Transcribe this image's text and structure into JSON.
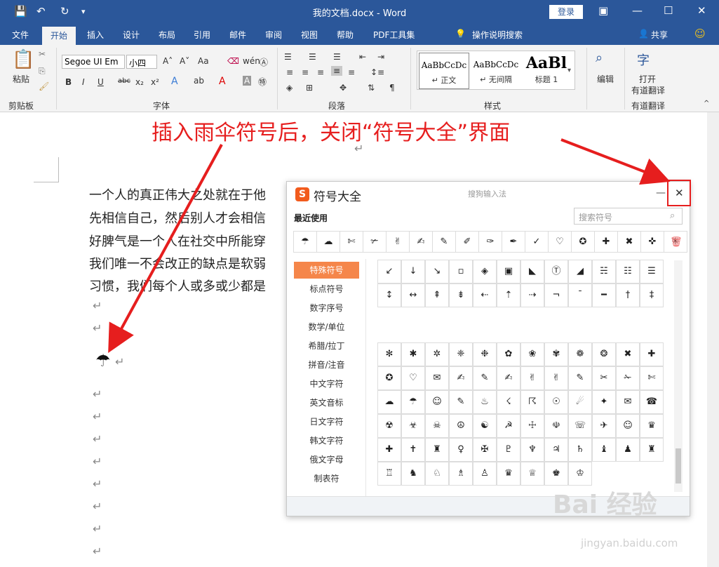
{
  "titlebar": {
    "title": "我的文档.docx  -  Word",
    "login": "登录",
    "save_icon": "💾",
    "undo_icon": "↶",
    "redo_icon": "↻",
    "more_icon": "▾",
    "ribbon_opt_icon": "▣",
    "min_icon": "—",
    "max_icon": "☐",
    "close_icon": "✕"
  },
  "tabs": {
    "items": [
      "文件",
      "开始",
      "插入",
      "设计",
      "布局",
      "引用",
      "邮件",
      "审阅",
      "视图",
      "帮助",
      "PDF工具集"
    ],
    "tell": "操作说明搜索",
    "share": "共享"
  },
  "ribbon": {
    "clipboard": {
      "paste": "粘贴",
      "label": "剪贴板"
    },
    "font": {
      "name": "Segoe UI Em",
      "size": "小四",
      "label": "字体",
      "bold": "B",
      "italic": "I",
      "underline": "U",
      "strike": "abc",
      "sub": "x₂",
      "sup": "x²",
      "aa": "Aa"
    },
    "paragraph": {
      "label": "段落"
    },
    "styles": {
      "label": "样式",
      "items": [
        {
          "sample": "AaBbCcDc",
          "name": "↵ 正文"
        },
        {
          "sample": "AaBbCcDc",
          "name": "↵ 无间隔"
        },
        {
          "sample": "AaBl",
          "name": "标题 1"
        }
      ]
    },
    "editing": {
      "label": "编辑"
    },
    "translate": {
      "btn1": "打开",
      "btn2": "有道翻译",
      "label": "有道翻译"
    }
  },
  "annotation": "插入雨伞符号后，关闭“符号大全”界面",
  "document": {
    "lines": [
      "一个人的真正伟大之处就在于他",
      "先相信自己，然后别人才会相信",
      "好脾气是一个人在社交中所能穿",
      "我们唯一不会改正的缺点是软弱",
      "习惯，我们每个人或多或少都是"
    ],
    "para_mark": "↵",
    "umbrella": "☂"
  },
  "dialog": {
    "logo": "S",
    "title": "符号大全",
    "subtitle": "搜狗输入法",
    "min_icon": "—",
    "close_icon": "✕",
    "recent_label": "最近使用",
    "search_placeholder": "搜索符号",
    "recent": [
      "☂",
      "☁",
      "✄",
      "✃",
      "✌",
      "✍",
      "✎",
      "✐",
      "✑",
      "✒",
      "✓",
      "♡",
      "✪",
      "✚",
      "✖",
      "✜",
      "✳"
    ],
    "categories": [
      "特殊符号",
      "标点符号",
      "数字序号",
      "数学/单位",
      "希腊/拉丁",
      "拼音/注音",
      "中文字符",
      "英文音标",
      "日文字符",
      "韩文字符",
      "俄文字母",
      "制表符"
    ],
    "grid_top": [
      "↙",
      "↓",
      "↘",
      "▫",
      "◈",
      "▣",
      "◣",
      "Ⓣ",
      "◢",
      "☵",
      "☷",
      "☰",
      "↕",
      "↔",
      "⇞",
      "⇟",
      "⇠",
      "⇡",
      "⇢",
      "¬",
      "¯",
      "━",
      "†",
      "‡"
    ],
    "grid_bottom": [
      "✻",
      "✱",
      "✲",
      "❈",
      "❉",
      "✿",
      "❀",
      "✾",
      "❁",
      "❂",
      "✖",
      "✚",
      "✪",
      "♡",
      "✉",
      "✍",
      "✎",
      "✍",
      "✌",
      "✌",
      "✎",
      "✂",
      "✁",
      "✄",
      "☁",
      "☂",
      "☺",
      "✎",
      "♨",
      "☇",
      "☈",
      "☉",
      "☄",
      "✦",
      "✉",
      "☎",
      "☢",
      "☣",
      "☠",
      "☮",
      "☯",
      "☭",
      "☩",
      "☫",
      "☏",
      "✈",
      "☺",
      "♛",
      "✚",
      "✝",
      "♜",
      "♀",
      "✠",
      "♇",
      "♆",
      "♃",
      "♄",
      "♝",
      "♟",
      "♜",
      "♖",
      "♞",
      "♘",
      "♗",
      "♙",
      "♛",
      "♕",
      "♚",
      "♔"
    ]
  },
  "watermark": "Bai 经验",
  "watermark_url": "jingyan.baidu.com"
}
